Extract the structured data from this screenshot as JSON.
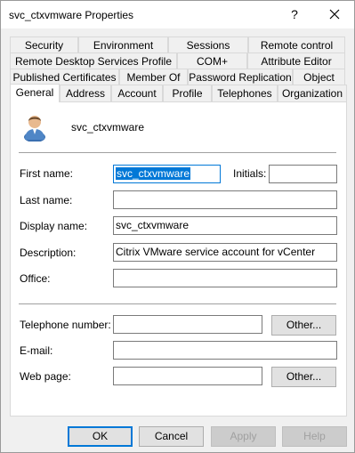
{
  "window": {
    "title": "svc_ctxvmware Properties",
    "help_glyph": "?"
  },
  "tabs": {
    "row1": [
      "Security",
      "Environment",
      "Sessions",
      "Remote control"
    ],
    "row2": [
      "Remote Desktop Services Profile",
      "COM+",
      "Attribute Editor"
    ],
    "row3": [
      "Published Certificates",
      "Member Of",
      "Password Replication",
      "Object"
    ],
    "row4": [
      "General",
      "Address",
      "Account",
      "Profile",
      "Telephones",
      "Organization"
    ],
    "active": "General"
  },
  "general": {
    "account_name": "svc_ctxvmware",
    "labels": {
      "first_name": "First name:",
      "initials": "Initials:",
      "last_name": "Last name:",
      "display_name": "Display name:",
      "description": "Description:",
      "office": "Office:",
      "telephone": "Telephone number:",
      "email": "E-mail:",
      "web_page": "Web page:"
    },
    "values": {
      "first_name": "svc_ctxvmware",
      "initials": "",
      "last_name": "",
      "display_name": "svc_ctxvmware",
      "description": "Citrix VMware service account for vCenter",
      "office": "",
      "telephone": "",
      "email": "",
      "web_page": ""
    },
    "other_telephone_label": "Other...",
    "other_web_label": "Other..."
  },
  "footer": {
    "ok": "OK",
    "cancel": "Cancel",
    "apply": "Apply",
    "help": "Help"
  },
  "colors": {
    "accent": "#0078d7",
    "dialog_bg": "#f0f0f0"
  }
}
